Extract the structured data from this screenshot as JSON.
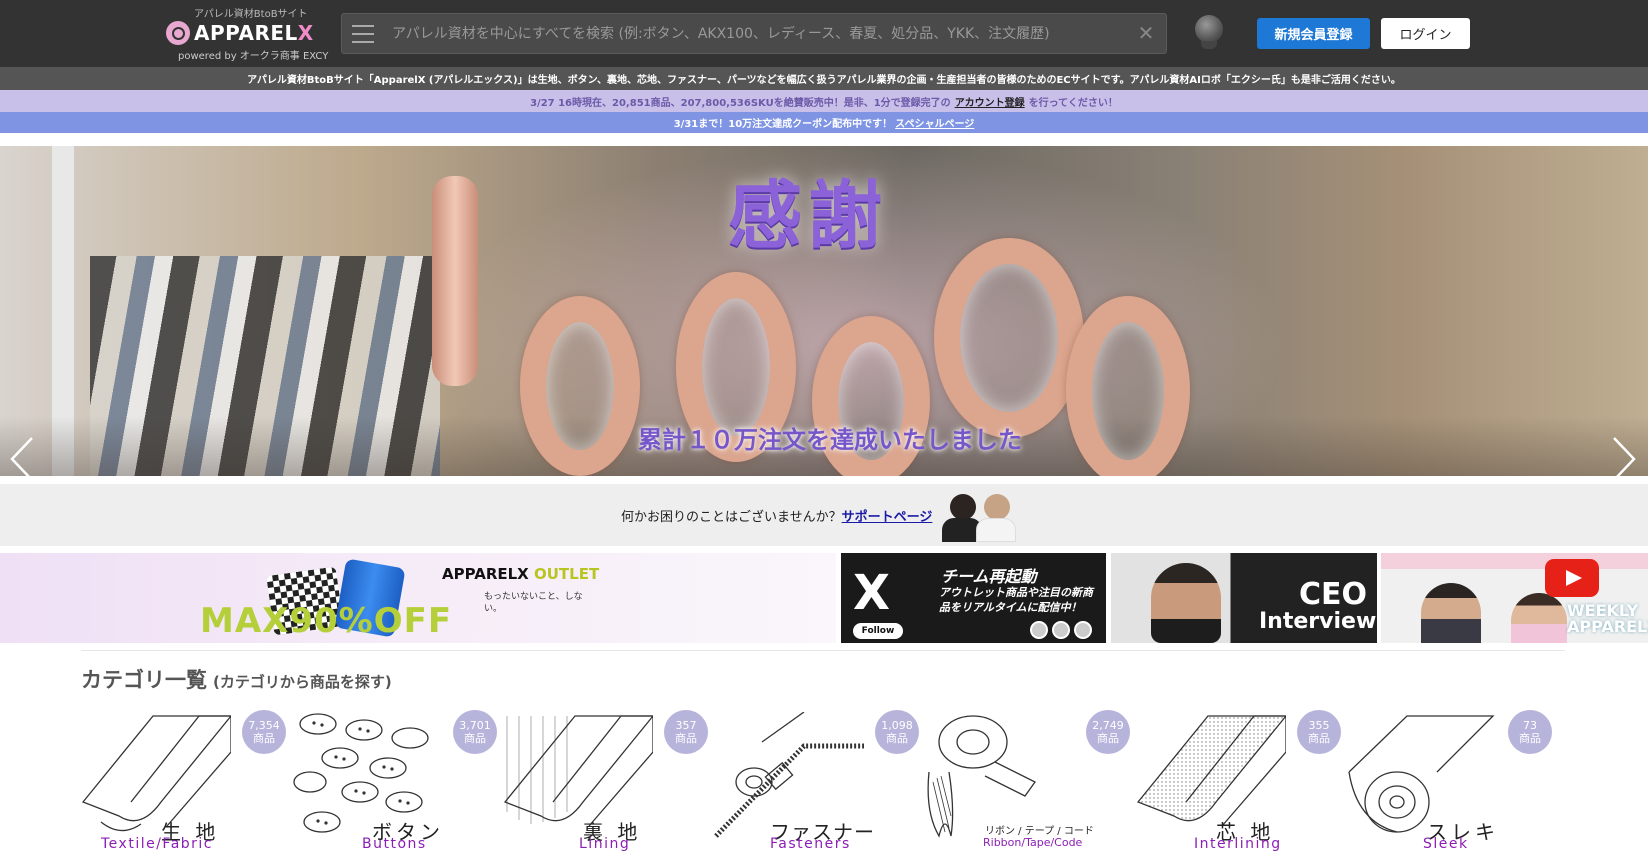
{
  "header": {
    "logo_tagline": "アパレル資材BtoBサイト",
    "logo_name": "APPAREL",
    "logo_x": "X",
    "logo_powered": "powered by オークラ商事 EXCY",
    "search_placeholder": "アパレル資材を中心にすべてを検索 (例:ボタン、AKX100、レディース、春夏、処分品、YKK、注文履歴)",
    "register_label": "新規会員登録",
    "login_label": "ログイン"
  },
  "info": {
    "bar1": "アパレル資材BtoBサイト「ApparelX (アパレルエックス)」は生地、ボタン、裏地、芯地、ファスナー、パーツなどを幅広く扱うアパレル業界の企画・生産担当者の皆様のためのECサイトです。アパレル資材AIロボ「エクシー氏」も是非ご活用ください。",
    "bar2_before": "3/27 16時現在、20,851商品、207,800,536SKUを絶賛販売中！是非、1分で登録完了の",
    "bar2_link": "アカウント登録",
    "bar2_after": "を行ってください！",
    "bar3_before": "3/31まで！10万注文達成クーポン配布中です！",
    "bar3_link": "スペシャルページ"
  },
  "hero": {
    "title": "感謝",
    "subtitle": "累計１０万注文を達成いたしました"
  },
  "support": {
    "text": "何かお困りのことはございませんか？",
    "link": "サポートページ"
  },
  "banners": {
    "outlet_title": "APPARELX",
    "outlet_title_accent": "OUTLET",
    "outlet_note": "もったいないこと、しない。",
    "outlet_sale": "MAX90%OFF",
    "x_logo": "X",
    "x_head": "チーム再起動",
    "x_desc": "アウトレット商品や注目の新商品をリアルタイムに配信中！",
    "x_follow": "Follow",
    "ceo_line1": "CEO",
    "ceo_line2": "Interview",
    "weekly_line1": "WEEKLY",
    "weekly_line2": "APPARELX"
  },
  "categories": {
    "heading": "カテゴリ一覧",
    "heading_sub": "(カテゴリから商品を探す)",
    "items": [
      {
        "jp": "生 地",
        "en": "Textile/Fabric",
        "count": "7,354",
        "unit": "商品"
      },
      {
        "jp": "ボタン",
        "en": "Buttons",
        "count": "3,701",
        "unit": "商品"
      },
      {
        "jp": "裏 地",
        "en": "Lining",
        "count": "357",
        "unit": "商品"
      },
      {
        "jp": "ファスナー",
        "en": "Fasteners",
        "count": "1,098",
        "unit": "商品"
      },
      {
        "jp": "リボン / テープ / コード",
        "en": "Ribbon/Tape/Code",
        "count": "2,749",
        "unit": "商品"
      },
      {
        "jp": "芯 地",
        "en": "Interlining",
        "count": "355",
        "unit": "商品"
      },
      {
        "jp": "スレキ",
        "en": "Sleek",
        "count": "73",
        "unit": "商品"
      }
    ]
  }
}
